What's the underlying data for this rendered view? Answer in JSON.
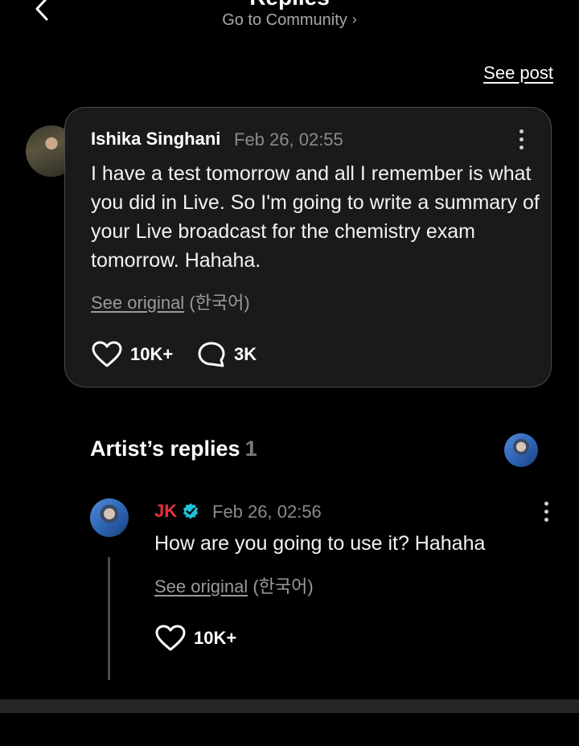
{
  "header": {
    "title": "Replies",
    "community_link": "Go to Community",
    "chevron": "›",
    "back_icon": "chevron-left-icon"
  },
  "see_post": "See post",
  "post": {
    "author": "Ishika Singhani",
    "date": "Feb 26, 02:55",
    "body": "I have a test tomorrow and all I remember is what you did in Live. So I'm going to write a summary of your Live broadcast for the chemistry exam tomorrow. Hahaha.",
    "see_original": "See original",
    "language": "(한국어)",
    "likes": "10K+",
    "comments": "3K"
  },
  "artist_replies": {
    "title": "Artist’s replies",
    "count": "1"
  },
  "reply": {
    "author": "JK",
    "date": "Feb 26, 02:56",
    "body": "How are you going to use it? Hahaha",
    "see_original": "See original",
    "language": "(한국어)",
    "likes": "10K+"
  },
  "colors": {
    "background": "#000000",
    "card": "#1a1a1a",
    "artist_name": "#e3323b",
    "verified": "#1fc0d6",
    "muted": "#8a8a8a"
  }
}
